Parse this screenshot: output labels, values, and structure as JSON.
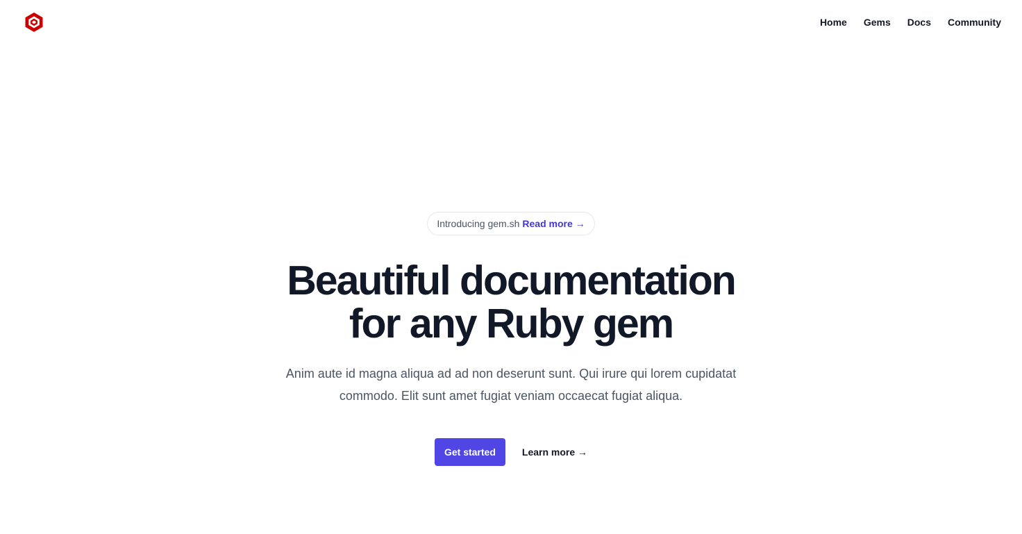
{
  "brand": {
    "logo_icon": "hexagon-logo-icon",
    "logo_color": "#cc0000"
  },
  "nav": {
    "items": [
      {
        "label": "Home"
      },
      {
        "label": "Gems"
      },
      {
        "label": "Docs"
      },
      {
        "label": "Community"
      }
    ]
  },
  "hero": {
    "announcement": {
      "text": "Introducing gem.sh",
      "link_label": "Read more →"
    },
    "title_line1": "Beautiful documentation",
    "title_line2": "for any Ruby gem",
    "description_line1": "Anim aute id magna aliqua ad ad non deserunt sunt. Qui irure qui lorem cupidatat",
    "description_line2": "commodo. Elit sunt amet fugiat veniam occaecat fugiat aliqua.",
    "primary_cta": "Get started",
    "secondary_cta": "Learn more →"
  },
  "colors": {
    "accent": "#4f46e5",
    "accent_text": "#4338ca",
    "heading": "#111827",
    "body_text": "#4b5563"
  }
}
